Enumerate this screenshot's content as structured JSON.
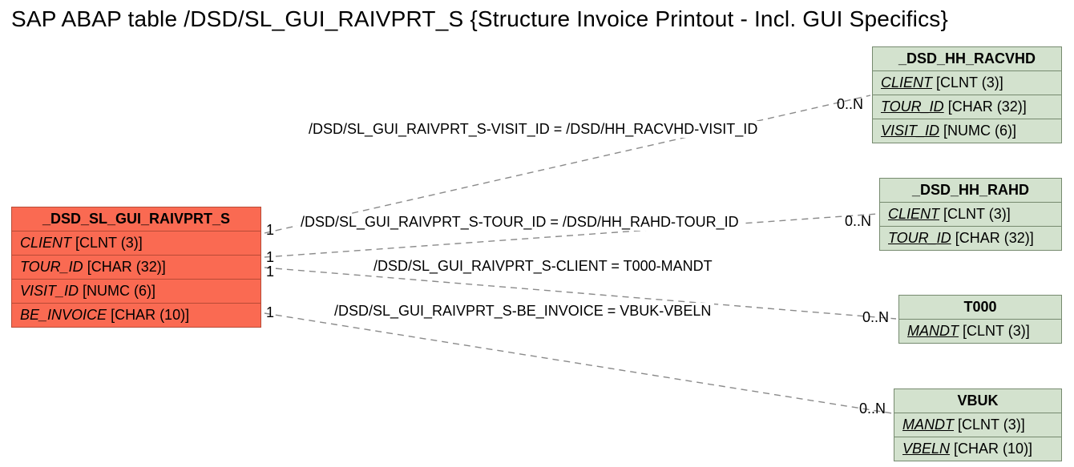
{
  "title": "SAP ABAP table /DSD/SL_GUI_RAIVPRT_S {Structure Invoice Printout - Incl. GUI Specifics}",
  "sourceEntity": {
    "header": "_DSD_SL_GUI_RAIVPRT_S",
    "fields": [
      {
        "name": "CLIENT",
        "type": "[CLNT (3)]"
      },
      {
        "name": "TOUR_ID",
        "type": "[CHAR (32)]"
      },
      {
        "name": "VISIT_ID",
        "type": "[NUMC (6)]"
      },
      {
        "name": "BE_INVOICE",
        "type": "[CHAR (10)]"
      }
    ]
  },
  "targets": [
    {
      "header": "_DSD_HH_RACVHD",
      "fields": [
        {
          "name": "CLIENT",
          "type": "[CLNT (3)]",
          "underline": true
        },
        {
          "name": "TOUR_ID",
          "type": "[CHAR (32)]",
          "underline": true
        },
        {
          "name": "VISIT_ID",
          "type": "[NUMC (6)]",
          "underline": true
        }
      ]
    },
    {
      "header": "_DSD_HH_RAHD",
      "fields": [
        {
          "name": "CLIENT",
          "type": "[CLNT (3)]",
          "underline": true
        },
        {
          "name": "TOUR_ID",
          "type": "[CHAR (32)]",
          "underline": true
        }
      ]
    },
    {
      "header": "T000",
      "fields": [
        {
          "name": "MANDT",
          "type": "[CLNT (3)]",
          "underline": true
        }
      ]
    },
    {
      "header": "VBUK",
      "fields": [
        {
          "name": "MANDT",
          "type": "[CLNT (3)]",
          "underline": true
        },
        {
          "name": "VBELN",
          "type": "[CHAR (10)]",
          "underline": true
        }
      ]
    }
  ],
  "relations": [
    {
      "label": "/DSD/SL_GUI_RAIVPRT_S-VISIT_ID = /DSD/HH_RACVHD-VISIT_ID",
      "leftCard": "1",
      "rightCard": "0..N"
    },
    {
      "label": "/DSD/SL_GUI_RAIVPRT_S-TOUR_ID = /DSD/HH_RAHD-TOUR_ID",
      "leftCard": "1",
      "rightCard": "0..N"
    },
    {
      "label": "/DSD/SL_GUI_RAIVPRT_S-CLIENT = T000-MANDT",
      "leftCard": "1",
      "rightCard": "0..N"
    },
    {
      "label": "/DSD/SL_GUI_RAIVPRT_S-BE_INVOICE = VBUK-VBELN",
      "leftCard": "1",
      "rightCard": "0..N"
    }
  ]
}
